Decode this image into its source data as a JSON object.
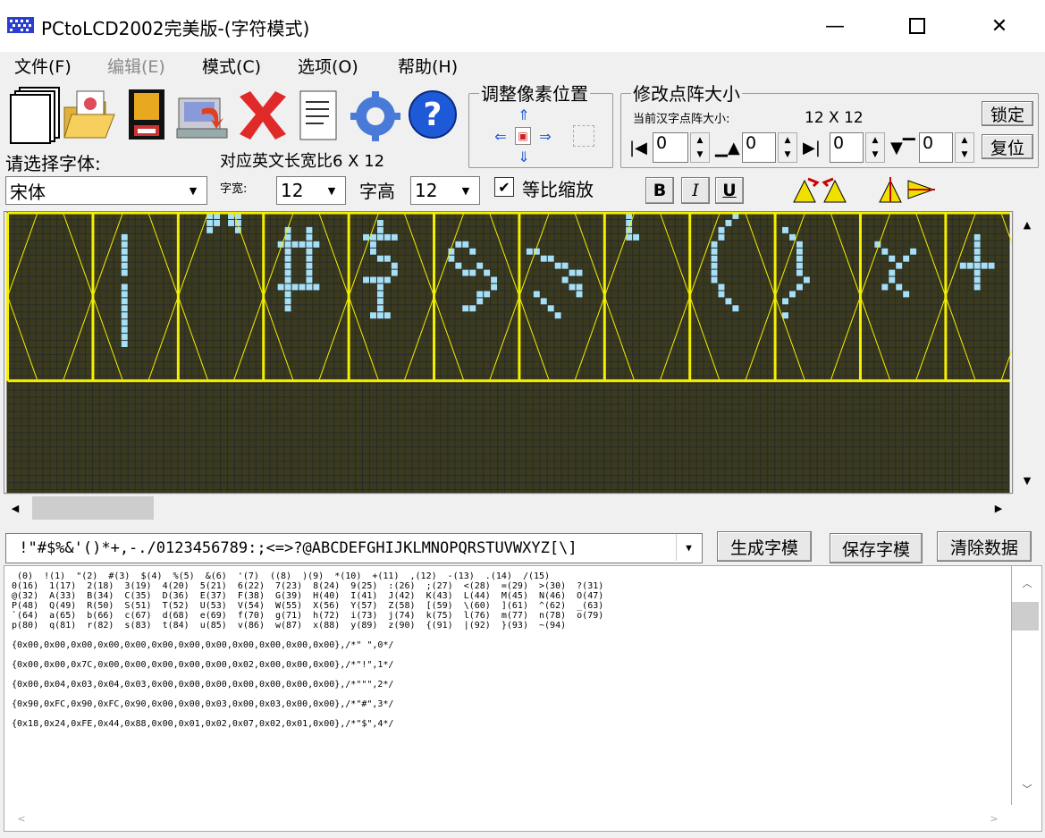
{
  "window": {
    "title": "PCtoLCD2002完美版-(字符模式)",
    "min_glyph": "—",
    "max_glyph": "☐",
    "close_glyph": "✕"
  },
  "menu": [
    "文件(F)",
    "编辑(E)",
    "模式(C)",
    "选项(O)",
    "帮助(H)"
  ],
  "toolbar": {
    "icons": [
      "new-file-icon",
      "open-folder-icon",
      "save-disk-icon",
      "save-computer-icon",
      "delete-x-icon",
      "notepad-icon",
      "settings-gear-icon",
      "help-question-icon"
    ]
  },
  "adjust_pixel": {
    "title": "调整像素位置"
  },
  "matrix_size": {
    "title": "修改点阵大小",
    "current_label": "当前汉字点阵大小:",
    "current_value": "12 X 12",
    "lock_button": "锁定",
    "reset_button": "复位",
    "spin_values": [
      "0",
      "0",
      "0",
      "0"
    ]
  },
  "font": {
    "select_label": "请选择字体:",
    "font_value": "宋体",
    "ratio_label": "对应英文长宽比6 X 12",
    "width_label": "字宽:",
    "width_value": "12",
    "height_label": "字高",
    "height_value": "12",
    "proportional_label": "等比缩放",
    "proportional_checked": true,
    "bold": "B",
    "italic": "I",
    "underline": "U"
  },
  "input": {
    "chars_value": " !\"#$%&'()*+,-./0123456789:;<=>?@ABCDEFGHIJKLMNOPQRSTUVWXYZ[\\]",
    "generate_button": "生成字模",
    "save_button": "保存字模",
    "clear_button": "清除数据"
  },
  "output": {
    "lines": [
      " (0)  !(1)  \"(2)  #(3)  $(4)  %(5)  &(6)  '(7)  ((8)  )(9)  *(10)  +(11)  ,(12)  -(13)  .(14)  /(15)",
      "0(16)  1(17)  2(18)  3(19)  4(20)  5(21)  6(22)  7(23)  8(24)  9(25)  :(26)  ;(27)  <(28)  =(29)  >(30)  ?(31)",
      "@(32)  A(33)  B(34)  C(35)  D(36)  E(37)  F(38)  G(39)  H(40)  I(41)  J(42)  K(43)  L(44)  M(45)  N(46)  O(47)",
      "P(48)  Q(49)  R(50)  S(51)  T(52)  U(53)  V(54)  W(55)  X(56)  Y(57)  Z(58)  [(59)  \\(60)  ](61)  ^(62)  _(63)",
      "`(64)  a(65)  b(66)  c(67)  d(68)  e(69)  f(70)  g(71)  h(72)  i(73)  j(74)  k(75)  l(76)  m(77)  n(78)  o(79)",
      "p(80)  q(81)  r(82)  s(83)  t(84)  u(85)  v(86)  w(87)  x(88)  y(89)  z(90)  {(91)  |(92)  }(93)  ~(94)",
      "",
      "{0x00,0x00,0x00,0x00,0x00,0x00,0x00,0x00,0x00,0x00,0x00,0x00},/*\" \",0*/",
      "",
      "{0x00,0x00,0x7C,0x00,0x00,0x00,0x00,0x00,0x02,0x00,0x00,0x00},/*\"!\",1*/",
      "",
      "{0x00,0x04,0x03,0x04,0x03,0x00,0x00,0x00,0x00,0x00,0x00,0x00},/*\"\"\",2*/",
      "",
      "{0x90,0xFC,0x90,0xFC,0x90,0x00,0x00,0x03,0x00,0x03,0x00,0x00},/*\"#\",3*/",
      "",
      "{0x18,0x24,0xFE,0x44,0x88,0x00,0x01,0x02,0x07,0x02,0x01,0x00},/*\"$\",4*/"
    ]
  },
  "colors": {
    "grid_bg": "#3a3a1e",
    "grid_line": "#2a2a2a",
    "pixel_on": "#a6e0f5",
    "cell_border": "#f5f000"
  }
}
